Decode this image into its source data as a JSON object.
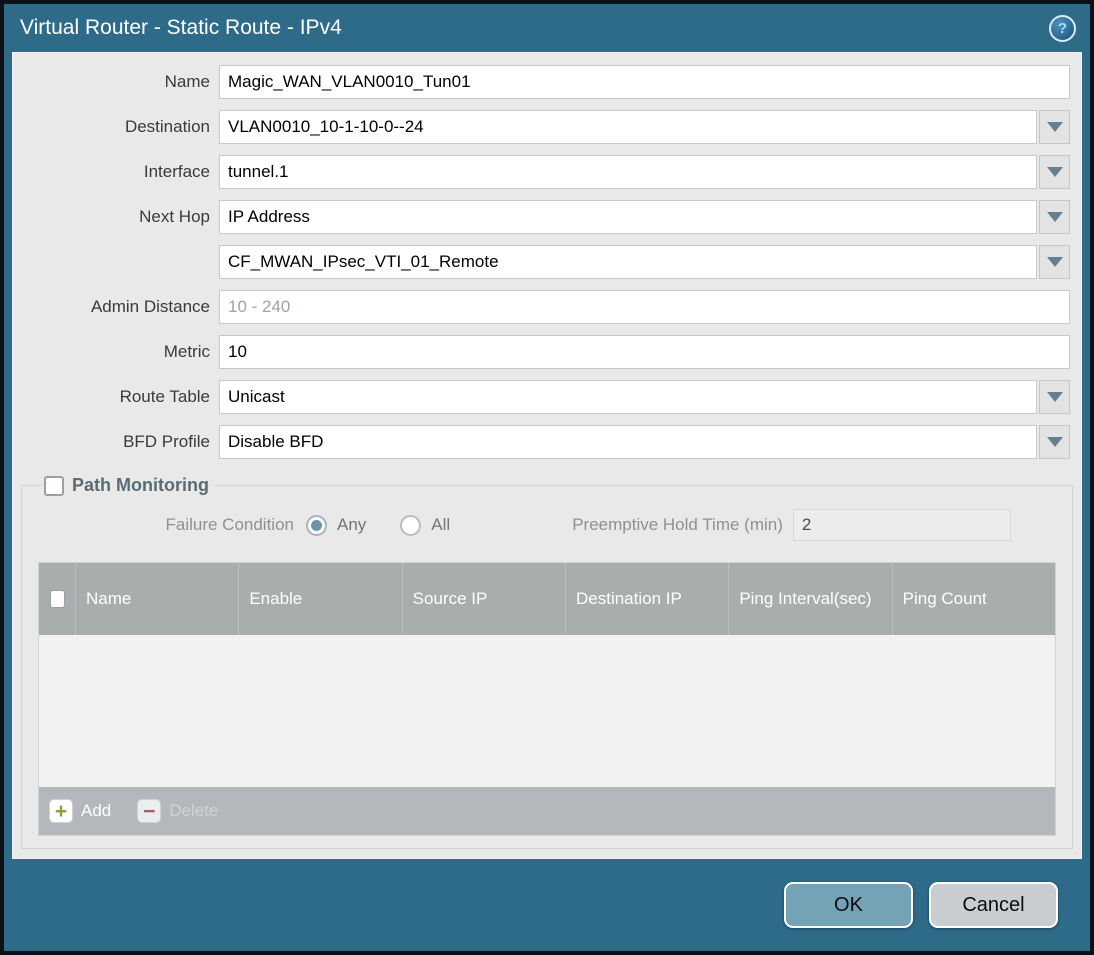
{
  "titlebar": {
    "title": "Virtual Router - Static Route - IPv4",
    "help_glyph": "?"
  },
  "form": {
    "name": {
      "label": "Name",
      "value": "Magic_WAN_VLAN0010_Tun01"
    },
    "destination": {
      "label": "Destination",
      "value": "VLAN0010_10-1-10-0--24"
    },
    "interface": {
      "label": "Interface",
      "value": "tunnel.1"
    },
    "next_hop": {
      "label": "Next Hop",
      "value": "IP Address"
    },
    "next_hop_address": {
      "value": "CF_MWAN_IPsec_VTI_01_Remote"
    },
    "admin_distance": {
      "label": "Admin Distance",
      "placeholder": "10 - 240"
    },
    "metric": {
      "label": "Metric",
      "value": "10"
    },
    "route_table": {
      "label": "Route Table",
      "value": "Unicast"
    },
    "bfd_profile": {
      "label": "BFD Profile",
      "value": "Disable BFD"
    }
  },
  "path_monitoring": {
    "title": "Path Monitoring",
    "checked": false,
    "failure_condition": {
      "label": "Failure Condition",
      "options": {
        "0": "Any",
        "1": "All"
      },
      "selected": "Any"
    },
    "hold_time": {
      "label": "Preemptive Hold Time (min)",
      "value": "2"
    },
    "table": {
      "columns": {
        "0": "Name",
        "1": "Enable",
        "2": "Source IP",
        "3": "Destination IP",
        "4": "Ping Interval(sec)",
        "5": "Ping Count"
      },
      "rows": []
    },
    "actions": {
      "add": "Add",
      "delete": "Delete",
      "delete_enabled": false
    }
  },
  "footer": {
    "ok": "OK",
    "cancel": "Cancel"
  },
  "colors": {
    "titlebar_teal": "#2e6b89",
    "content_gray": "#e9e9e9",
    "table_header_gray": "#a8aeae",
    "table_footer_gray": "#b2b8bb",
    "ok_button": "#74a2b7",
    "cancel_button": "#c9cdd1",
    "add_green": "#7fa43a",
    "delete_red": "#9c6060",
    "dropdown_arrow": "#67808f",
    "radio_selected": "#6e93a8"
  }
}
